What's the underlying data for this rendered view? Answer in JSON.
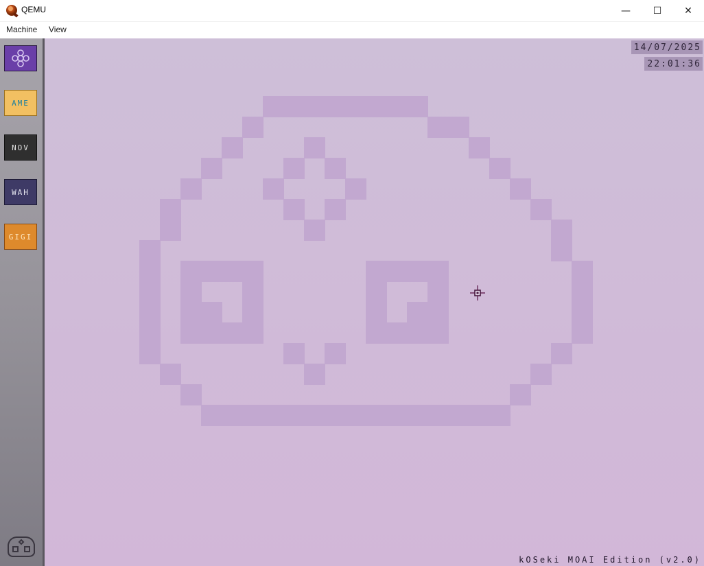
{
  "window": {
    "title": "QEMU",
    "minimize_glyph": "—",
    "maximize_glyph": "☐",
    "close_glyph": "✕"
  },
  "menu": {
    "items": [
      {
        "label": "Machine"
      },
      {
        "label": "View"
      }
    ]
  },
  "vm": {
    "date": "14/07/2025",
    "time": "22:01:36",
    "footer": "kOSeki MOAI Edition (v2.0)",
    "sidebar": {
      "settings_icon": "flower-gear-icon",
      "buttons": [
        {
          "label": "AME",
          "bg": "#f2c062",
          "fg": "#1a7fa0"
        },
        {
          "label": "NOV",
          "bg": "#2f2f2f",
          "fg": "#e0e0e0"
        },
        {
          "label": "WAH",
          "bg": "#3e3a66",
          "fg": "#e6e6f0"
        },
        {
          "label": "GIGI",
          "bg": "#de8a2c",
          "fg": "#ffe8c0"
        }
      ],
      "mascot_icon": "moai-face-icon"
    },
    "colors": {
      "screen_bg": "#cfbcd8",
      "moai_pixels": "#c2a8d0",
      "settings_button": "#6a3fa8"
    },
    "cursor_icon": "crosshair-cursor-icon"
  }
}
